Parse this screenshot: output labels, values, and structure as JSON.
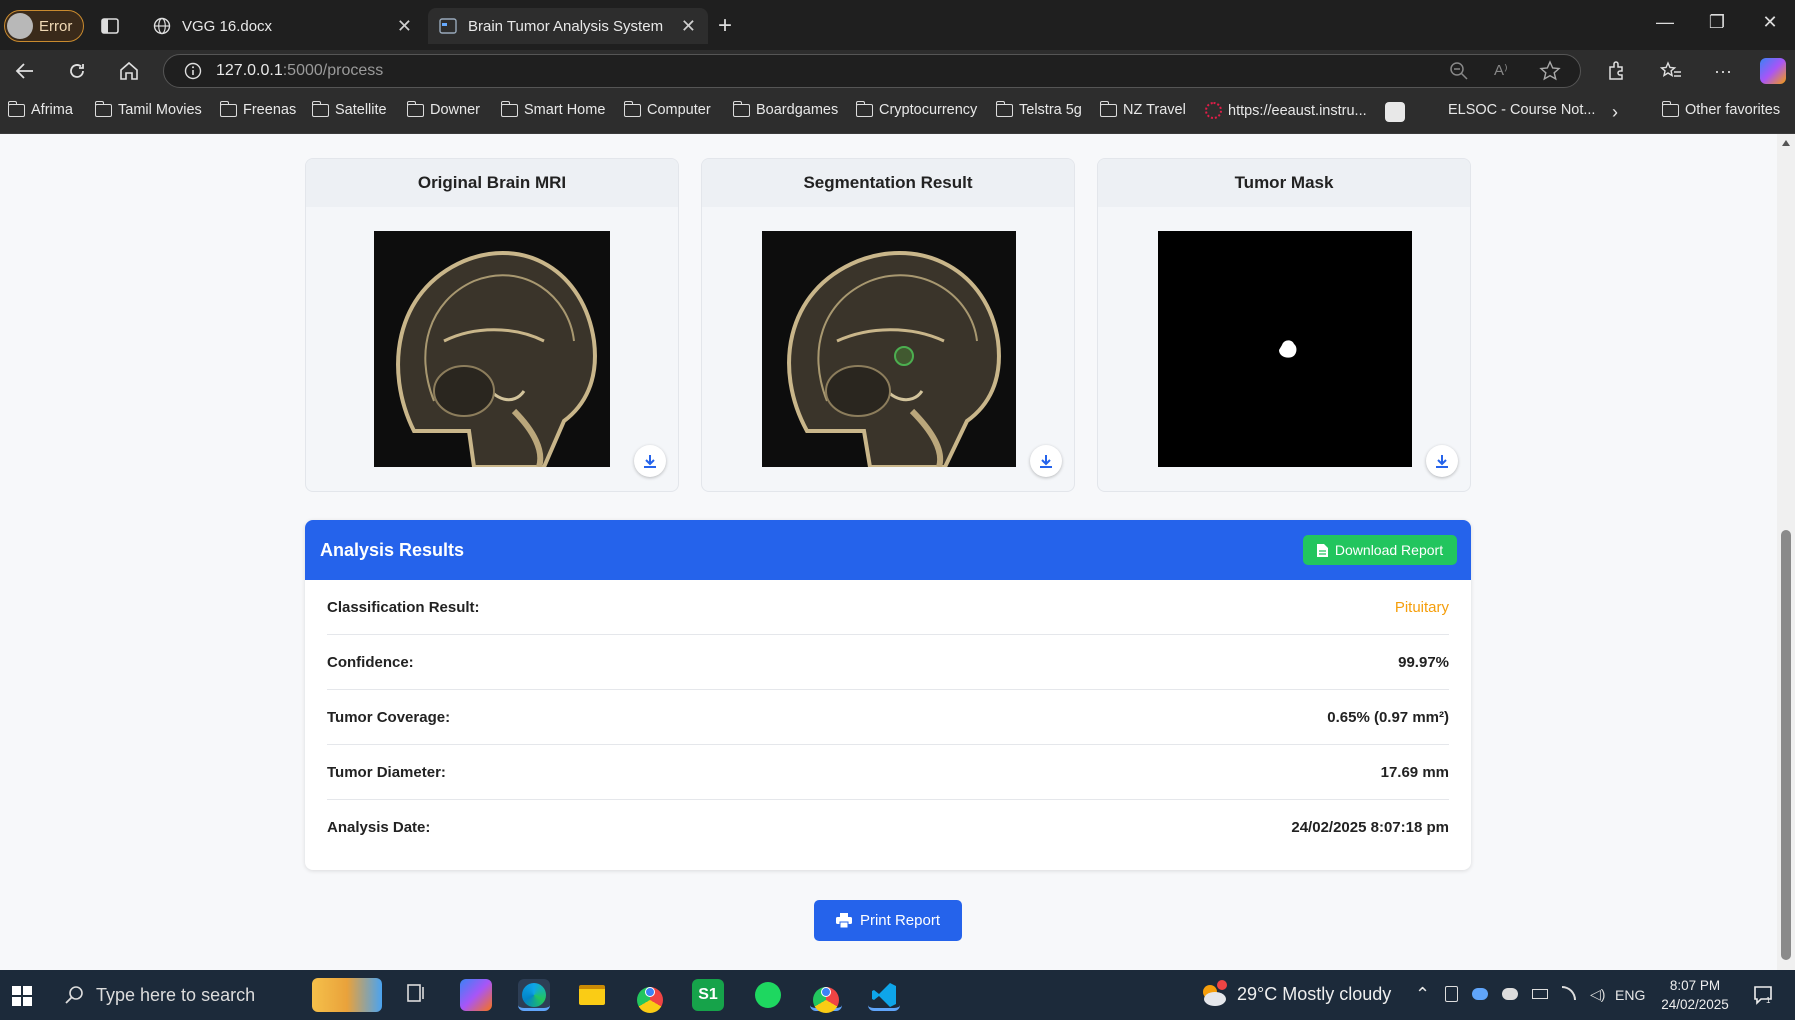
{
  "browser": {
    "profile_label": "Error",
    "tabs": [
      {
        "title": "VGG 16.docx"
      },
      {
        "title": "Brain Tumor Analysis System"
      }
    ],
    "address": {
      "host": "127.0.0.1",
      "path": ":5000/process"
    },
    "favorites": [
      "Afrima",
      "Tamil Movies",
      "Freenas",
      "Satellite",
      "Downer",
      "Smart Home",
      "Computer",
      "Boardgames",
      "Cryptocurrency",
      "Telstra 5g",
      "NZ Travel",
      "https://eeaust.instru...",
      "ELSOC - Course Not...",
      "Other favorites"
    ]
  },
  "images": [
    {
      "title": "Original Brain MRI"
    },
    {
      "title": "Segmentation Result"
    },
    {
      "title": "Tumor Mask"
    }
  ],
  "results": {
    "title": "Analysis Results",
    "download_label": "Download Report",
    "rows": [
      {
        "label": "Classification Result:",
        "value": "Pituitary",
        "color": "#f59e0b"
      },
      {
        "label": "Confidence:",
        "value": "99.97%",
        "color": "#222222"
      },
      {
        "label": "Tumor Coverage:",
        "value": "0.65% (0.97 mm²)",
        "color": "#222222"
      },
      {
        "label": "Tumor Diameter:",
        "value": "17.69 mm",
        "color": "#222222"
      },
      {
        "label": "Analysis Date:",
        "value": "24/02/2025 8:07:18 pm",
        "color": "#222222"
      }
    ]
  },
  "print_label": "Print Report",
  "taskbar": {
    "search_placeholder": "Type here to search",
    "weather": "29°C  Mostly cloudy",
    "language": "ENG",
    "time": "8:07 PM",
    "date": "24/02/2025"
  }
}
